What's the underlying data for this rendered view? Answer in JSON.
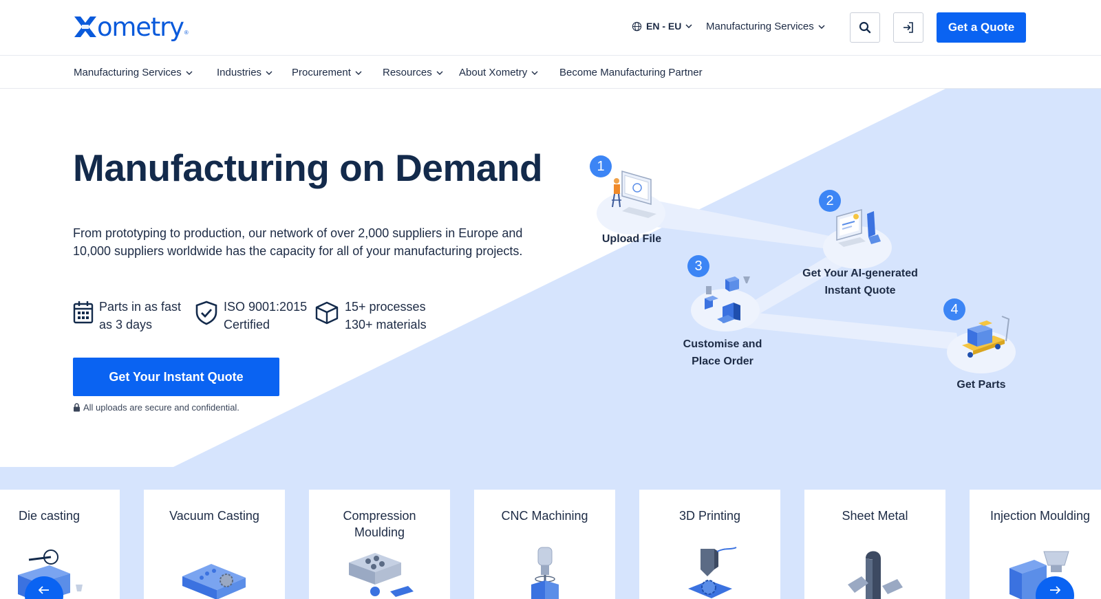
{
  "header": {
    "logo_text": "ometry",
    "lang": "EN - EU",
    "manufacturing_services": "Manufacturing Services",
    "get_quote": "Get a Quote"
  },
  "nav": {
    "items": [
      {
        "label": "Manufacturing Services",
        "dropdown": true
      },
      {
        "label": "Industries",
        "dropdown": true
      },
      {
        "label": "Procurement",
        "dropdown": true
      },
      {
        "label": "Resources",
        "dropdown": true
      },
      {
        "label": "About Xometry",
        "dropdown": true
      },
      {
        "label": "Become Manufacturing Partner",
        "dropdown": false
      }
    ]
  },
  "hero": {
    "title": "Manufacturing on Demand",
    "lead_line1": "From prototyping to production, our network of over 2,000 suppliers in Europe and",
    "lead_line2": "10,000 suppliers worldwide has the capacity for all of your manufacturing projects.",
    "features": [
      {
        "icon": "calendar-icon",
        "line1": "Parts in as fast",
        "line2": "as 3 days"
      },
      {
        "icon": "shield-check-icon",
        "line1": "ISO 9001:2015",
        "line2": "Certified"
      },
      {
        "icon": "box-icon",
        "line1": "15+ processes",
        "line2": "130+ materials"
      }
    ],
    "cta": "Get Your Instant Quote",
    "secure_note": "All uploads are secure and confidential."
  },
  "steps": [
    {
      "number": "1",
      "line1": "Upload File",
      "line2": ""
    },
    {
      "number": "2",
      "line1": "Get Your AI-generated",
      "line2": "Instant Quote"
    },
    {
      "number": "3",
      "line1": "Customise and",
      "line2": "Place Order"
    },
    {
      "number": "4",
      "line1": "Get Parts",
      "line2": ""
    }
  ],
  "services": [
    {
      "line1": "Die casting",
      "line2": ""
    },
    {
      "line1": "Vacuum Casting",
      "line2": ""
    },
    {
      "line1": "Compression",
      "line2": "Moulding"
    },
    {
      "line1": "CNC Machining",
      "line2": ""
    },
    {
      "line1": "3D Printing",
      "line2": ""
    },
    {
      "line1": "Sheet Metal",
      "line2": ""
    },
    {
      "line1": "Injection Moulding",
      "line2": ""
    }
  ],
  "colors": {
    "brand_blue": "#0a63f2",
    "navy_text": "#132a4b",
    "hero_band": "#d6e4fd",
    "step_badge": "#3c85f5"
  }
}
